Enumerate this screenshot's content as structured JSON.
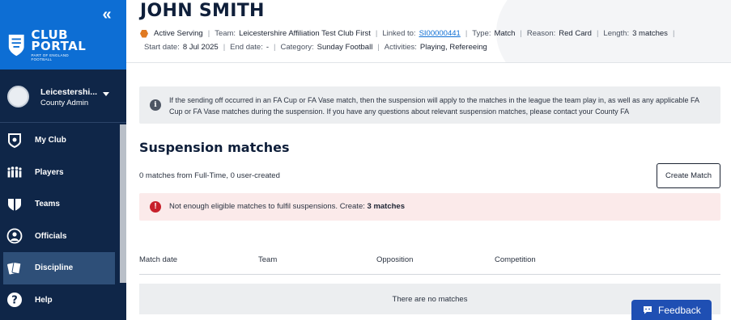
{
  "sidebar": {
    "collapse_glyph": "«",
    "logo": {
      "title_line1": "CLUB",
      "title_line2": "PORTAL",
      "subtitle": "PART OF ENGLAND FOOTBALL"
    },
    "account": {
      "name": "Leicestershi...",
      "role": "County Admin"
    },
    "nav": [
      {
        "label": "My Club",
        "icon": "shield-icon"
      },
      {
        "label": "Players",
        "icon": "players-icon"
      },
      {
        "label": "Teams",
        "icon": "teams-icon"
      },
      {
        "label": "Officials",
        "icon": "whistle-icon"
      },
      {
        "label": "Discipline",
        "icon": "cards-icon",
        "active": true
      },
      {
        "label": "Help",
        "icon": "help-icon"
      }
    ]
  },
  "header": {
    "player_name": "JOHN SMITH",
    "status": "Active Serving",
    "status_color": "#e07a22",
    "team_label": "Team:",
    "team_value": "Leicestershire Affiliation Test Club First",
    "linked_label": "Linked to:",
    "linked_value": "SI00000441",
    "type_label": "Type:",
    "type_value": "Match",
    "reason_label": "Reason:",
    "reason_value": "Red Card",
    "length_label": "Length:",
    "length_value": "3 matches",
    "start_label": "Start date:",
    "start_value": "8 Jul 2025",
    "end_label": "End date:",
    "end_value": "-",
    "category_label": "Category:",
    "category_value": "Sunday Football",
    "activities_label": "Activities:",
    "activities_value": "Playing, Refereeing"
  },
  "info": {
    "text": "If the sending off occurred in an FA Cup or FA Vase match, then the suspension will apply to the matches in the league the team play in, as well as any applicable FA Cup or FA Vase matches during the suspension. If you have any questions about relevant suspension matches, please contact your County FA"
  },
  "suspension": {
    "title": "Suspension matches",
    "summary": "0 matches from Full-Time, 0 user-created",
    "create_label": "Create Match",
    "error_text": "Not enough eligible matches to fulfil suspensions. Create:",
    "error_count": "3 matches",
    "columns": [
      "Match date",
      "Team",
      "Opposition",
      "Competition"
    ],
    "empty_text": "There are no matches"
  },
  "feedback": {
    "label": "Feedback"
  },
  "colors": {
    "sidebar_bg": "#0f2648",
    "brand_blue": "#0d6ed4",
    "error_red": "#c7202b",
    "feedback_blue": "#1f4fb3"
  }
}
